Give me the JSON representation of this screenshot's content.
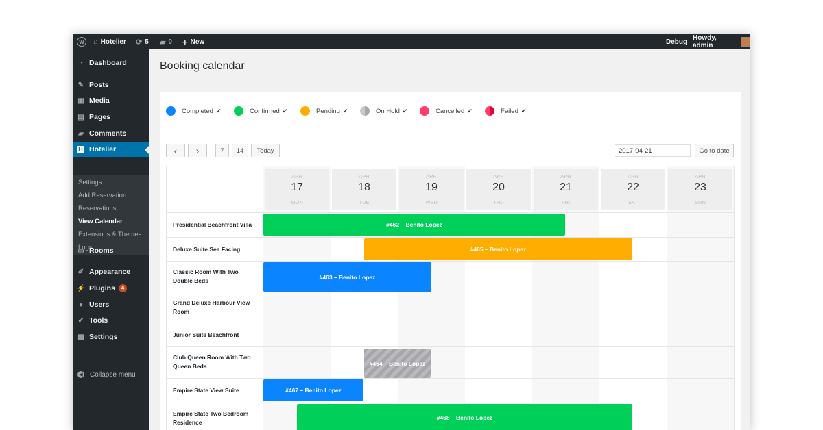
{
  "adminbar": {
    "site_name": "Hotelier",
    "updates": "5",
    "comments": "0",
    "new_label": "New",
    "debug": "Debug",
    "howdy": "Howdy, admin"
  },
  "sidebar": {
    "items": [
      {
        "label": "Dashboard",
        "icon": "dashboard-icon"
      },
      {
        "label": "Posts",
        "icon": "pin-icon"
      },
      {
        "label": "Media",
        "icon": "media-icon"
      },
      {
        "label": "Pages",
        "icon": "pages-icon"
      },
      {
        "label": "Comments",
        "icon": "comment-icon"
      },
      {
        "label": "Hotelier",
        "icon": "hotelier-icon"
      },
      {
        "label": "Rooms",
        "icon": "bed-icon"
      },
      {
        "label": "Appearance",
        "icon": "brush-icon"
      },
      {
        "label": "Plugins",
        "icon": "plug-icon",
        "badge": "4"
      },
      {
        "label": "Users",
        "icon": "users-icon"
      },
      {
        "label": "Tools",
        "icon": "wrench-icon"
      },
      {
        "label": "Settings",
        "icon": "settings-icon"
      }
    ],
    "submenu": [
      "Settings",
      "Add Reservation",
      "Reservations",
      "View Calendar",
      "Extensions & Themes",
      "Logs"
    ],
    "collapse_label": "Collapse menu"
  },
  "page_title": "Booking calendar",
  "legend": [
    {
      "label": "Completed",
      "color": "#0a84ff"
    },
    {
      "label": "Confirmed",
      "color": "#00d05a"
    },
    {
      "label": "Pending",
      "color": "#ffad00"
    },
    {
      "label": "On Hold",
      "color": "#a8a8ae"
    },
    {
      "label": "Cancelled",
      "color": "#ff3d6e"
    },
    {
      "label": "Failed",
      "color": "#ff1744"
    }
  ],
  "toolbar": {
    "prev": "‹",
    "next": "›",
    "view7": "7",
    "view14": "14",
    "today": "Today",
    "date_value": "2017-04-21",
    "go_to_date": "Go to date"
  },
  "days": [
    {
      "month": "APR",
      "day": "17",
      "weekday": "MON"
    },
    {
      "month": "APR",
      "day": "18",
      "weekday": "TUE"
    },
    {
      "month": "APR",
      "day": "19",
      "weekday": "WED"
    },
    {
      "month": "APR",
      "day": "20",
      "weekday": "THU"
    },
    {
      "month": "APR",
      "day": "21",
      "weekday": "FRI"
    },
    {
      "month": "APR",
      "day": "22",
      "weekday": "SAT"
    },
    {
      "month": "APR",
      "day": "23",
      "weekday": "SUN"
    }
  ],
  "rooms": [
    "Presidential Beachfront Villa",
    "Deluxe Suite Sea Facing",
    "Classic Room With Two Double Beds",
    "Grand Deluxe Harbour View Room",
    "Junior Suite Beachfront",
    "Club Queen Room With Two Queen Beds",
    "Empire State View Suite",
    "Empire State Two Bedroom Residence"
  ],
  "bookings": [
    {
      "label": "#462 – Benito Lopez",
      "status": "Confirmed",
      "color": "#00d05a"
    },
    {
      "label": "#465 – Benito Lopez",
      "status": "Pending",
      "color": "#ffad00"
    },
    {
      "label": "#463 – Benito Lopez",
      "status": "Completed",
      "color": "#0a84ff"
    },
    {
      "label": "#464 – Benito Lopez",
      "status": "On Hold",
      "color": "#a8a8ae"
    },
    {
      "label": "#467 – Benito Lopez",
      "status": "Completed",
      "color": "#0a84ff"
    },
    {
      "label": "#468 – Benito Lopez",
      "status": "Confirmed",
      "color": "#00d05a"
    }
  ]
}
